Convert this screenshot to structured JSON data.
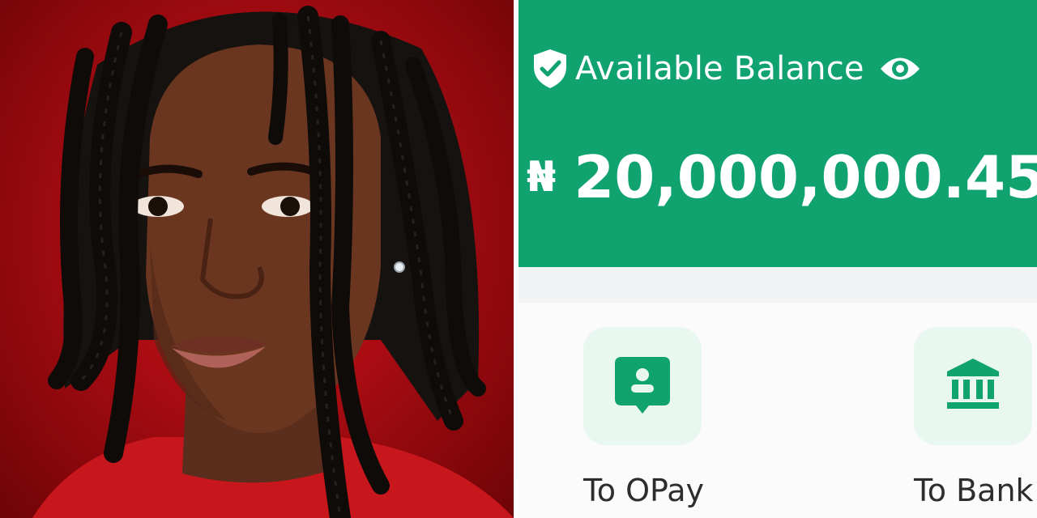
{
  "balance": {
    "label": "Available Balance",
    "currency_symbol": "₦",
    "amount": "20,000,000.45",
    "shield_icon": "shield-check-icon",
    "visibility_icon": "eye-icon"
  },
  "actions": [
    {
      "label": "To OPay",
      "icon": "user-chat-icon"
    },
    {
      "label": "To Bank",
      "icon": "bank-icon"
    }
  ],
  "colors": {
    "brand_green": "#10a36f",
    "tile_bg": "#e8f7ef",
    "photo_background": "#b30d14"
  }
}
